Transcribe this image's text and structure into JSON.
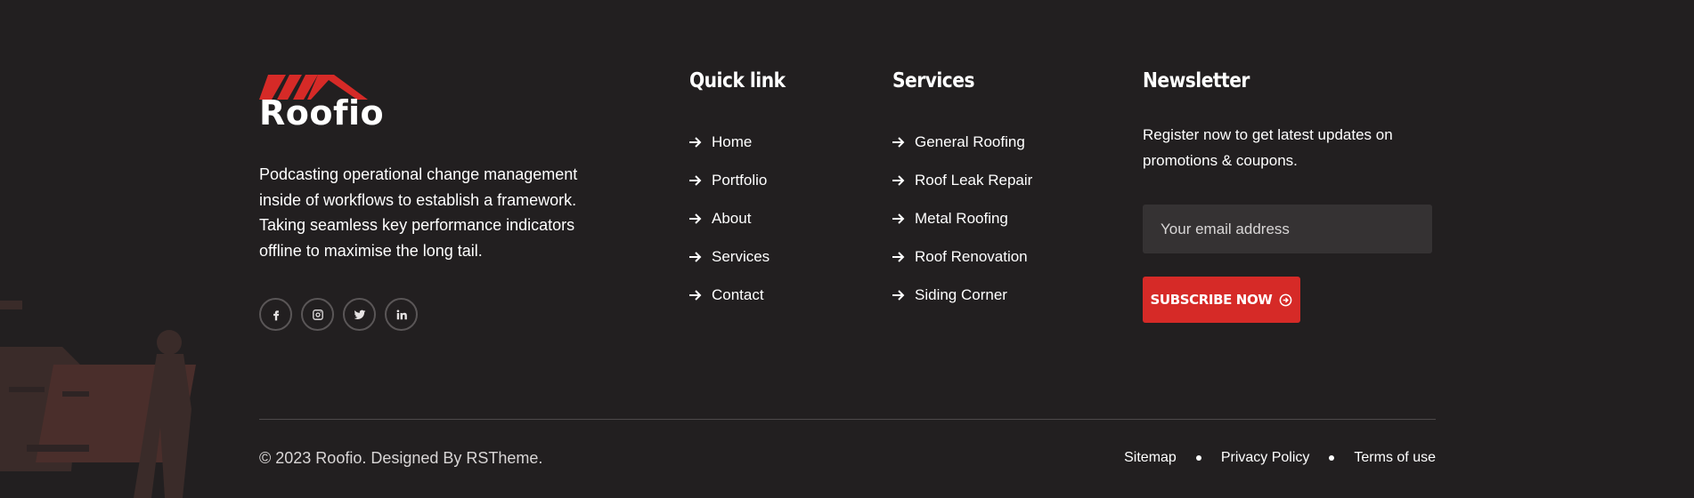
{
  "brand": {
    "name": "Roofio",
    "accent": "#d62a27",
    "background": "#221f20"
  },
  "about": "Podcasting operational change management inside of workflows to establish a framework. Taking seamless key performance indicators offline to maximise the long tail.",
  "socials": [
    {
      "icon": "facebook-icon"
    },
    {
      "icon": "instagram-icon"
    },
    {
      "icon": "twitter-icon"
    },
    {
      "icon": "linkedin-icon"
    }
  ],
  "quick_links": {
    "title": "Quick link",
    "items": [
      "Home",
      "Portfolio",
      "About",
      "Services",
      "Contact"
    ]
  },
  "services": {
    "title": "Services",
    "items": [
      "General Roofing",
      "Roof Leak Repair",
      "Metal Roofing",
      "Roof Renovation",
      "Siding Corner"
    ]
  },
  "newsletter": {
    "title": "Newsletter",
    "text": "Register now to get latest updates on promotions & coupons.",
    "email_placeholder": "Your email address",
    "button_label": "SUBSCRIBE NOW"
  },
  "footer": {
    "copyright": "© 2023 Roofio. Designed By RSTheme.",
    "links": [
      "Sitemap",
      "Privacy Policy",
      "Terms of use"
    ]
  }
}
